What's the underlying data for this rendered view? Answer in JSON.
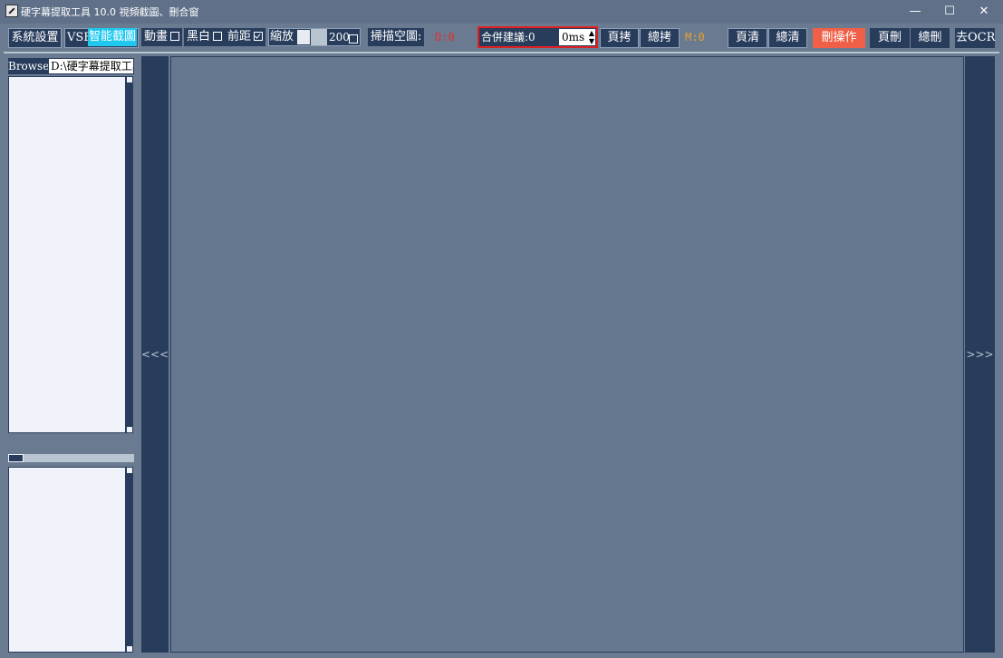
{
  "window": {
    "title": "硬字幕提取工具 10.0   視頻截圖、刪合窗",
    "minimize_glyph": "—",
    "maximize_glyph": "☐",
    "close_glyph": "✕"
  },
  "toolbar": {
    "system_settings": "系統設置",
    "vsf": "VSF",
    "smart_capture": "智能截圖",
    "motion_label": "動畫",
    "motion_checked": false,
    "bw_label": "黑白",
    "bw_checked": false,
    "front_margin_label": "前距",
    "front_margin_checked": true,
    "zoom_label": "縮放",
    "zoom_value": "200",
    "zoom_checked": false,
    "scan_empty_label": "掃描空圖:",
    "scan_empty_value": "D:0",
    "merge_suggest_label": "合併建議:0",
    "merge_ms_value": "0ms",
    "page_copy": "頁拷",
    "total_copy": "總拷",
    "m_value": "M:0",
    "page_clear": "頁清",
    "total_clear": "總清",
    "delete_op": "刪操作",
    "page_delete": "頁刪",
    "total_delete": "總刪",
    "to_ocr": "去OCR"
  },
  "left_panel": {
    "browse_label": "Browse",
    "path_value": "D:\\硬字幕提取工具"
  },
  "nav": {
    "prev": "<<<",
    "next": ">>>"
  },
  "colors": {
    "accent_cyan": "#20c8f0",
    "delete_button": "#f06048",
    "merge_border": "#e02020",
    "dark_button": "#283d5c",
    "canvas": "#66788f"
  }
}
